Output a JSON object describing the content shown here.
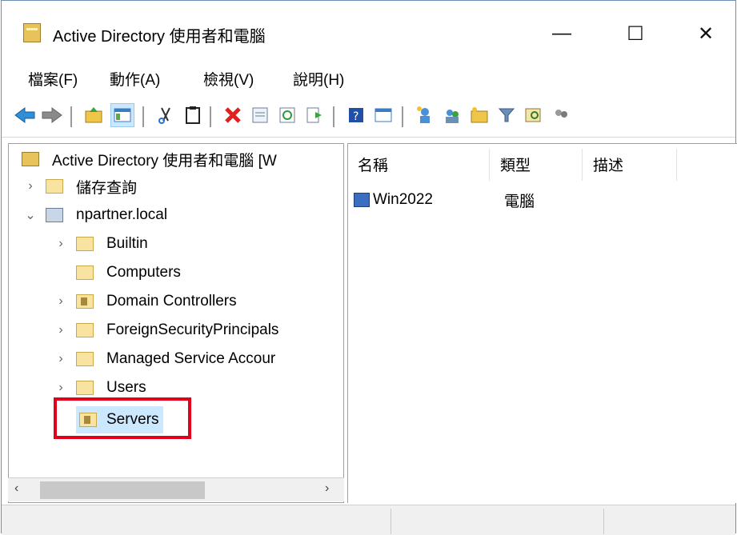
{
  "window": {
    "title": "Active Directory 使用者和電腦",
    "minimize": "—",
    "maximize": "☐",
    "close": "✕"
  },
  "menu": [
    "檔案(F)",
    "動作(A)",
    "檢視(V)",
    "說明(H)"
  ],
  "tree": {
    "root": "Active Directory 使用者和電腦 [W",
    "saved_queries": "儲存查詢",
    "domain": "npartner.local",
    "children": [
      "Builtin",
      "Computers",
      "Domain Controllers",
      "ForeignSecurityPrincipals",
      "Managed Service Accour",
      "Users",
      "Servers"
    ]
  },
  "list": {
    "columns": [
      "名稱",
      "類型",
      "描述"
    ],
    "rows": [
      {
        "name": "Win2022",
        "type": "電腦",
        "description": ""
      }
    ]
  },
  "colors": {
    "highlight_box": "#e0001b",
    "selection": "#cce8ff"
  }
}
